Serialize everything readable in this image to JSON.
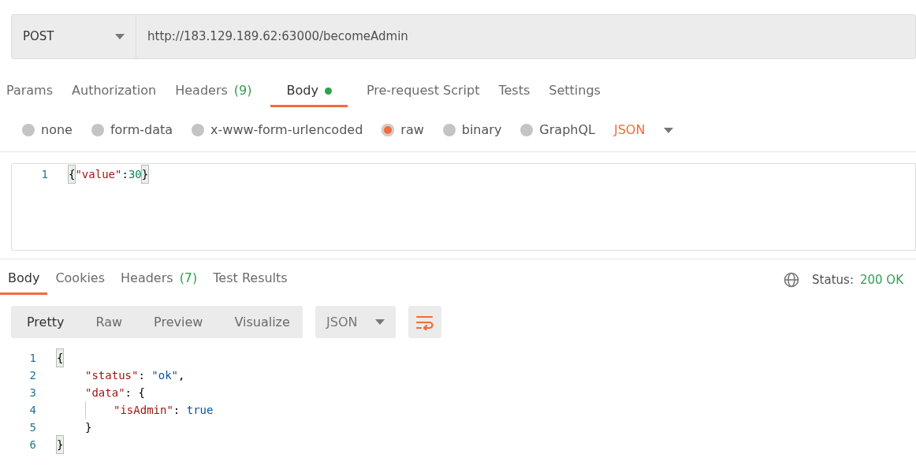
{
  "request": {
    "method": "POST",
    "url": "http://183.129.189.62:63000/becomeAdmin"
  },
  "request_tabs": [
    {
      "label": "Params",
      "selected": false
    },
    {
      "label": "Authorization",
      "selected": false
    },
    {
      "label": "Headers",
      "count": "(9)",
      "selected": false
    },
    {
      "label": "Body",
      "selected": true,
      "indicator": true
    },
    {
      "label": "Pre-request Script",
      "selected": false
    },
    {
      "label": "Tests",
      "selected": false
    },
    {
      "label": "Settings",
      "selected": false
    }
  ],
  "body_types": [
    {
      "label": "none",
      "selected": false
    },
    {
      "label": "form-data",
      "selected": false
    },
    {
      "label": "x-www-form-urlencoded",
      "selected": false
    },
    {
      "label": "raw",
      "selected": true
    },
    {
      "label": "binary",
      "selected": false
    },
    {
      "label": "GraphQL",
      "selected": false
    }
  ],
  "raw_format": "JSON",
  "request_body": [
    {
      "line": "1",
      "tokens": [
        {
          "text": "{",
          "kind": "bracket"
        },
        {
          "text": "\"value\"",
          "kind": "key"
        },
        {
          "text": ":",
          "kind": "punct"
        },
        {
          "text": "30",
          "kind": "number"
        },
        {
          "text": "}",
          "kind": "bracket"
        }
      ]
    }
  ],
  "response_tabs": [
    {
      "label": "Body",
      "selected": true
    },
    {
      "label": "Cookies",
      "selected": false
    },
    {
      "label": "Headers",
      "count": "(7)",
      "selected": false
    },
    {
      "label": "Test Results",
      "selected": false
    }
  ],
  "status": {
    "label": "Status:",
    "value": "200 OK"
  },
  "view_modes": [
    {
      "label": "Pretty",
      "selected": true
    },
    {
      "label": "Raw",
      "selected": false
    },
    {
      "label": "Preview",
      "selected": false
    },
    {
      "label": "Visualize",
      "selected": false
    }
  ],
  "response_format": "JSON",
  "response_body": [
    {
      "line": "1",
      "tokens": [
        {
          "text": "{",
          "kind": "bracket"
        }
      ],
      "children": [
        {
          "line": "2",
          "tokens": [
            {
              "text": "\"status\"",
              "kind": "key"
            },
            {
              "text": ": ",
              "kind": "punct"
            },
            {
              "text": "\"ok\"",
              "kind": "string"
            },
            {
              "text": ",",
              "kind": "punct"
            }
          ]
        },
        {
          "line": "3",
          "tokens": [
            {
              "text": "\"data\"",
              "kind": "key"
            },
            {
              "text": ": {",
              "kind": "punct"
            }
          ],
          "children": [
            {
              "line": "4",
              "tokens": [
                {
                  "text": "\"isAdmin\"",
                  "kind": "key"
                },
                {
                  "text": ": ",
                  "kind": "punct"
                },
                {
                  "text": "true",
                  "kind": "bool"
                }
              ]
            }
          ]
        },
        {
          "line": "5",
          "tokens": [
            {
              "text": "}",
              "kind": "punct"
            }
          ]
        }
      ]
    },
    {
      "line": "6",
      "tokens": [
        {
          "text": "}",
          "kind": "bracket"
        }
      ]
    }
  ]
}
